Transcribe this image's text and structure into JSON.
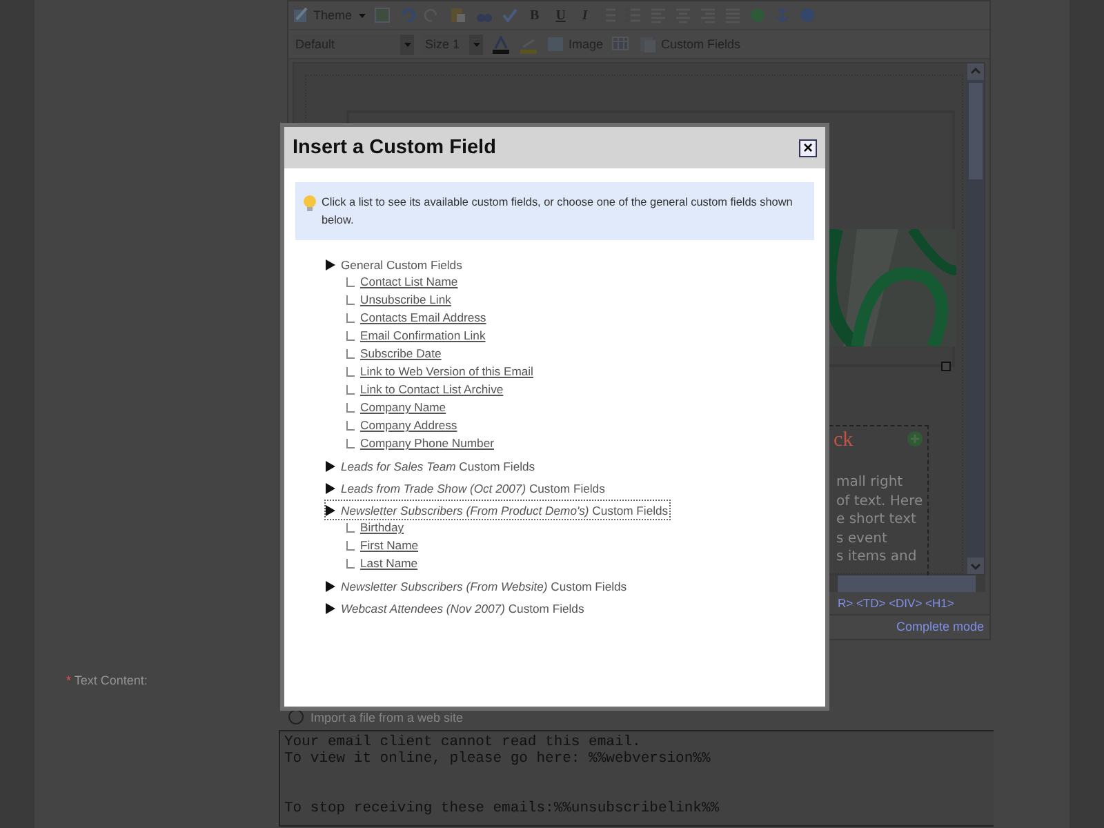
{
  "editor": {
    "toolbar_top": {
      "theme": "Theme",
      "format": [
        "B",
        "U",
        "I"
      ]
    },
    "toolbar_bottom": {
      "font": "Default",
      "size": "Size 1",
      "image": "Image",
      "custom_fields": "Custom Fields"
    },
    "content_fragments": {
      "heading": "ck",
      "lines": [
        "mall right",
        "of text. Here",
        "e short text",
        "s event",
        "s items and"
      ]
    },
    "path": "R> <TD> <DIV> <H1>",
    "mode": "Complete mode"
  },
  "form": {
    "label": "Text Content:",
    "required_mark": "*",
    "import_option": {
      "label": "Import a file from a web site",
      "selected": false
    },
    "text_paragraphs": [
      [
        "Your email client cannot read this email.",
        "To view it online, please go here: %%webversion%%"
      ],
      [
        "To stop receiving these emails:%%unsubscribelink%%"
      ]
    ]
  },
  "dialog": {
    "title": "Insert a Custom Field",
    "close": "×",
    "info": "Click a list to see its available custom fields, or choose one of the general custom fields shown below.",
    "groups": [
      {
        "label": "General Custom Fields",
        "focused": false,
        "children": [
          "Contact List Name",
          "Unsubscribe Link",
          "Contacts Email Address",
          "Email Confirmation Link",
          "Subscribe Date",
          "Link to Web Version of this Email",
          "Link to Contact List Archive",
          "Company Name",
          "Company Address",
          "Company Phone Number"
        ]
      },
      {
        "label": "*Leads for Sales Team* Custom Fields",
        "focused": false
      },
      {
        "label": "*Leads from Trade Show (Oct 2007)* Custom Fields",
        "focused": false
      },
      {
        "label": "*Newsletter Subscribers (From Product Demo's)* Custom Fields",
        "focused": true,
        "children": [
          "Birthday",
          "First Name",
          "Last Name"
        ]
      },
      {
        "label": "*Newsletter Subscribers (From Website)* Custom Fields",
        "focused": false
      },
      {
        "label": "*Webcast Attendees (Nov 2007)* Custom Fields",
        "focused": false
      }
    ]
  }
}
